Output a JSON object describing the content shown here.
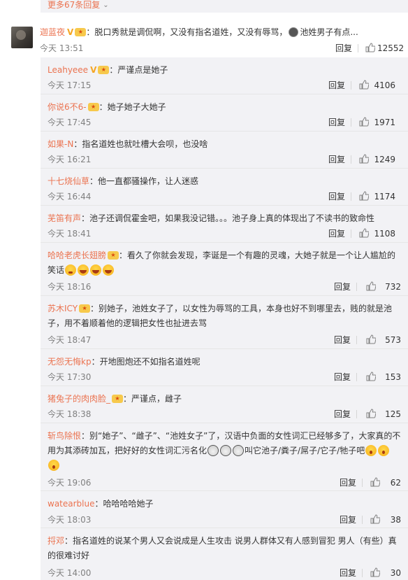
{
  "more_replies": {
    "label": "更多67条回复"
  },
  "top_comment": {
    "username": "迦蓝夜",
    "text": "：脱口秀就是调侃啊，又没有指名道姓，又没有辱骂，",
    "mention": "池姓男子有点...",
    "time": "今天 13:51",
    "reply_label": "回复",
    "likes": "12552"
  },
  "replies": [
    {
      "username": "Leahyeee",
      "text": "：严谨点是她子",
      "time": "今天 17:15",
      "reply_label": "回复",
      "likes": "4106"
    },
    {
      "username": "你说6不6-",
      "text": "：她子她子大她子",
      "time": "今天 17:45",
      "reply_label": "回复",
      "likes": "1971"
    },
    {
      "username": "如果-N",
      "text": "：指名道姓也就吐槽大会呗，也没啥",
      "time": "今天 16:21",
      "reply_label": "回复",
      "likes": "1249"
    },
    {
      "username": "十七烧仙草",
      "text": "：他一直都骚操作，让人迷惑",
      "time": "今天 16:44",
      "reply_label": "回复",
      "likes": "1174"
    },
    {
      "username": "芜笛有声",
      "text": "：池子还调侃霍金吧，如果我没记错。。。池子身上真的体现出了不读书的致命性",
      "time": "今天 18:41",
      "reply_label": "回复",
      "likes": "1108"
    },
    {
      "username": "哈哈老虎长翅膀",
      "text": "：看久了你就会发现，李诞是一个有趣的灵魂，大她子就是一个让人尴尬的笑话",
      "time": "今天 18:16",
      "reply_label": "回复",
      "likes": "732"
    },
    {
      "username": "苏木ICY",
      "text": "：别她子，池姓女子了，以女性为辱骂的工具，本身也好不到哪里去，贱的就是池子，用不着顺着他的逻辑把女性也扯进去骂",
      "time": "今天 18:47",
      "reply_label": "回复",
      "likes": "573"
    },
    {
      "username": "无怨无悔kp",
      "text": "：开地图炮还不如指名道姓呢",
      "time": "今天 17:30",
      "reply_label": "回复",
      "likes": "153"
    },
    {
      "username": "猪兔子的肉肉脸_",
      "text": "：严谨点，雌子",
      "time": "今天 18:38",
      "reply_label": "回复",
      "likes": "125"
    },
    {
      "username": "斩鸟除恨",
      "text": "：别“她子”、“雌子”、“池姓女子”了，汉语中负面的女性词汇已经够多了，大家真的不用为其添砖加瓦，把好好的女性词汇污名化",
      "text2": "叫它池子/粪子/屌子/它子/牠子吧",
      "time": "今天 19:06",
      "reply_label": "回复",
      "likes": "62"
    },
    {
      "username": "watearblue",
      "text": "：哈哈哈哈她子",
      "time": "今天 18:03",
      "reply_label": "回复",
      "likes": "38"
    },
    {
      "username": "捋邓",
      "text": "：指名道姓的说某个男人又会说成是人生攻击 说男人群体又有人感到冒犯 男人（有些）真的很难讨好",
      "time": "今天 14:00",
      "reply_label": "回复",
      "likes": "30"
    }
  ],
  "colors": {
    "username": "#eb7350",
    "background": "#f2f2f5",
    "badge_gold": "#f5a623"
  }
}
